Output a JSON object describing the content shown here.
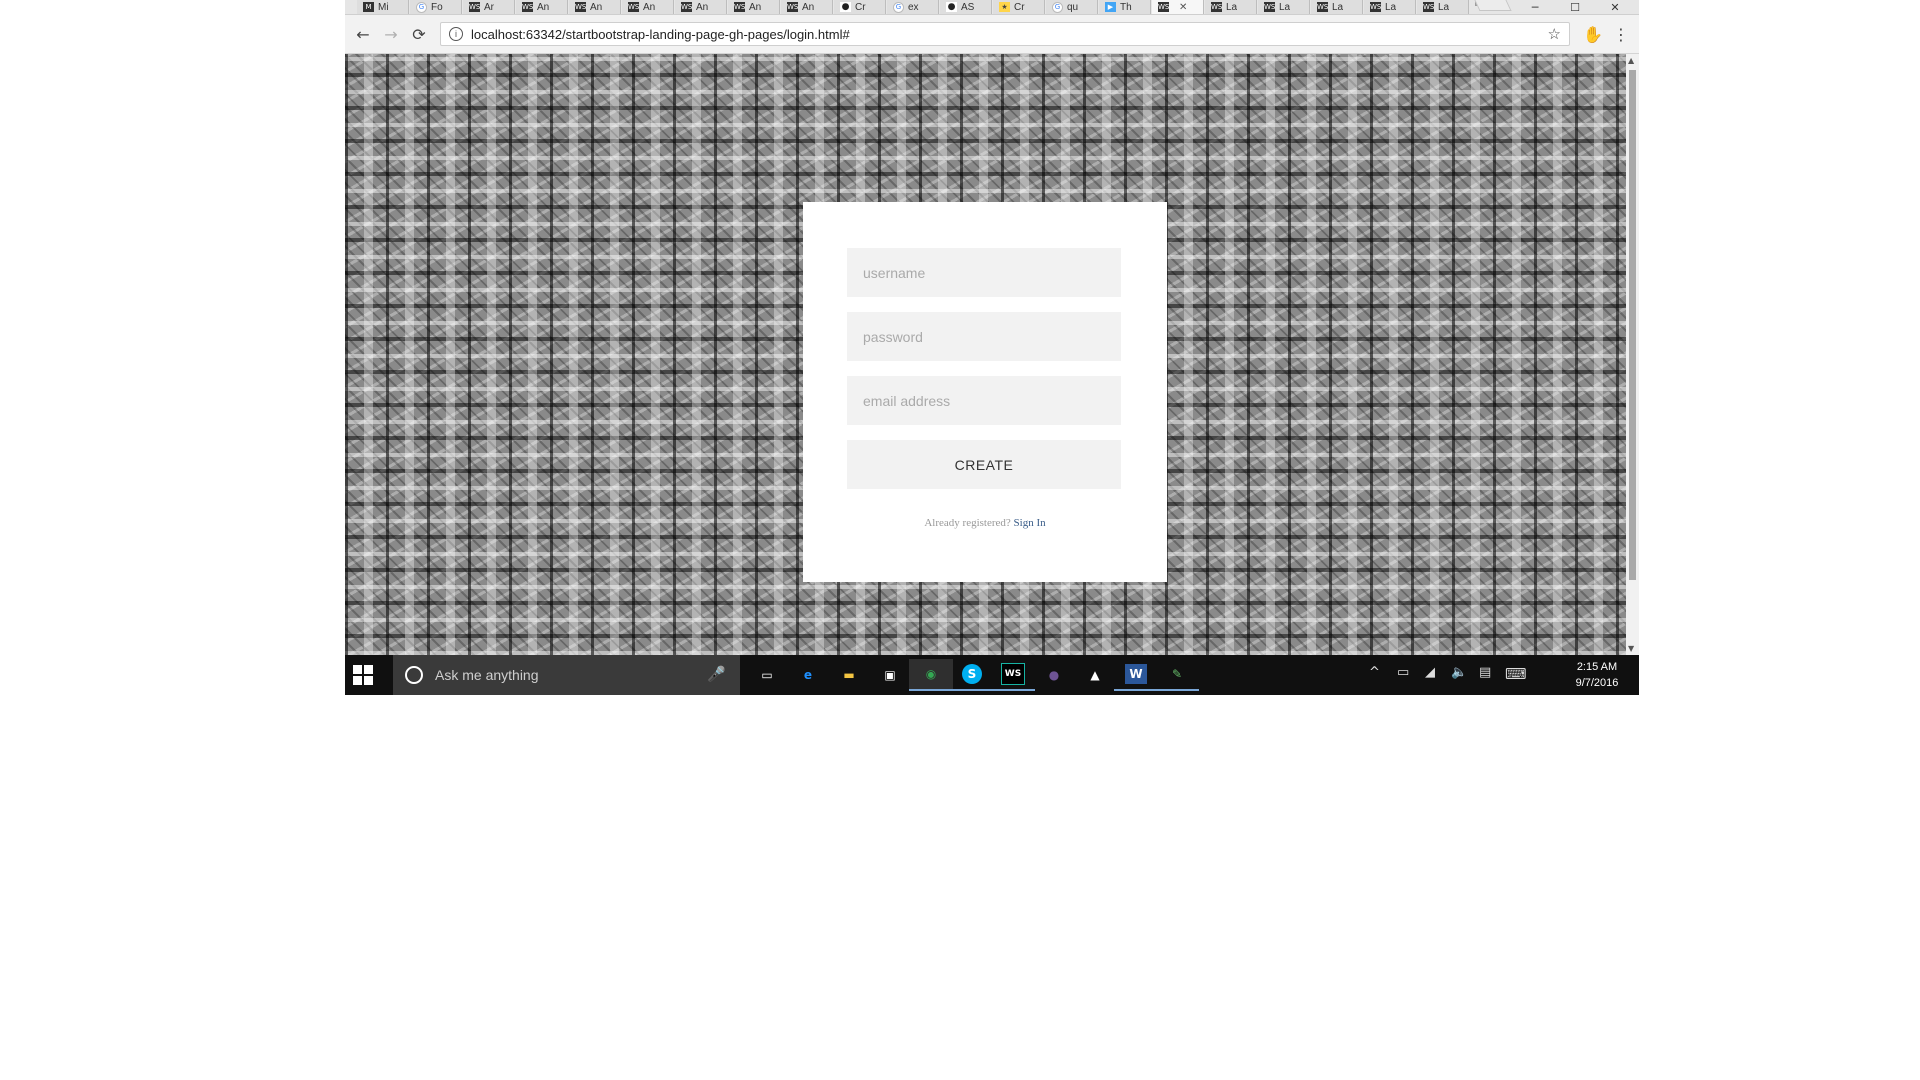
{
  "browser": {
    "tabs": [
      {
        "favicon": "M",
        "title": "Mi"
      },
      {
        "favicon": "G",
        "title": "Fo"
      },
      {
        "favicon": "WS",
        "title": "Ar"
      },
      {
        "favicon": "WS",
        "title": "An"
      },
      {
        "favicon": "WS",
        "title": "An"
      },
      {
        "favicon": "WS",
        "title": "An"
      },
      {
        "favicon": "WS",
        "title": "An"
      },
      {
        "favicon": "WS",
        "title": "An"
      },
      {
        "favicon": "WS",
        "title": "An"
      },
      {
        "favicon": "gh",
        "title": "Cr"
      },
      {
        "favicon": "G",
        "title": "ex"
      },
      {
        "favicon": "gh",
        "title": "AS"
      },
      {
        "favicon": "star",
        "title": "Cr"
      },
      {
        "favicon": "G",
        "title": "qu"
      },
      {
        "favicon": "flag",
        "title": "Th"
      },
      {
        "favicon": "WS",
        "title": "",
        "active": true
      },
      {
        "favicon": "WS",
        "title": "La"
      },
      {
        "favicon": "WS",
        "title": "La"
      },
      {
        "favicon": "WS",
        "title": "La"
      },
      {
        "favicon": "WS",
        "title": "La"
      },
      {
        "favicon": "WS",
        "title": "La"
      }
    ],
    "tab_close_glyph": "✕",
    "window_controls": {
      "minimize": "─",
      "maximize": "☐",
      "close": "✕"
    },
    "nav": {
      "back": "←",
      "forward": "→",
      "reload": "⟳"
    },
    "url": "localhost:63342/startbootstrap-landing-page-gh-pages/login.html#",
    "bookmark_icon": "☆",
    "menu_icon": "⋮",
    "extension_icon": "hand-icon"
  },
  "login": {
    "username_placeholder": "username",
    "password_placeholder": "password",
    "email_placeholder": "email address",
    "create_label": "CREATE",
    "already_text": "Already registered?",
    "signin_label": "Sign In"
  },
  "taskbar": {
    "search_placeholder": "Ask me anything",
    "apps": [
      {
        "name": "task-view",
        "glyph": "▭"
      },
      {
        "name": "edge",
        "glyph": "e",
        "color": "#1e90ff"
      },
      {
        "name": "file-explorer",
        "glyph": "▬",
        "color": "#f4c542"
      },
      {
        "name": "store",
        "glyph": "▣",
        "color": "#ffffff"
      },
      {
        "name": "chrome",
        "glyph": "◉",
        "color": "#34a853",
        "state": "active"
      },
      {
        "name": "skype",
        "glyph": "S",
        "color": "#00aff0",
        "state": "open"
      },
      {
        "name": "webstorm",
        "glyph": "WS",
        "color": "#16b3a3",
        "state": "open"
      },
      {
        "name": "github",
        "glyph": "●",
        "color": "#6e5494"
      },
      {
        "name": "photos",
        "glyph": "▲",
        "color": "#ffffff"
      },
      {
        "name": "word",
        "glyph": "W",
        "color": "#2b579a",
        "state": "open"
      },
      {
        "name": "paint",
        "glyph": "✎",
        "color": "#66bb6a",
        "state": "open"
      }
    ],
    "tray": {
      "chevron": "^",
      "battery": "▭",
      "network": "◢",
      "volume": "🔈",
      "notifications": "▤",
      "keyboard": "⌨"
    },
    "time": "2:15 AM",
    "date": "9/7/2016"
  }
}
